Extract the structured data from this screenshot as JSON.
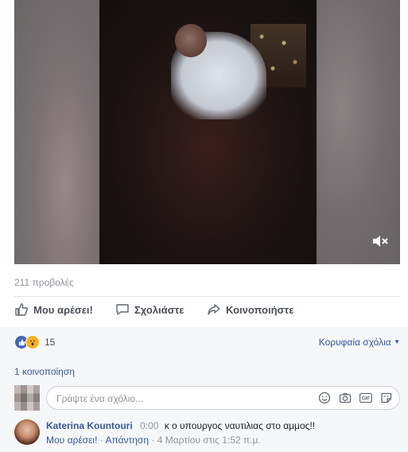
{
  "video": {
    "mute_icon": "volume-mute-icon"
  },
  "post": {
    "views": "211 προβολές"
  },
  "actions": {
    "like": "Μου αρέσει!",
    "comment": "Σχολιάστε",
    "share": "Κοινοποιήστε"
  },
  "reactions": {
    "count": "15",
    "top_comments": "Κορυφαία σχόλια",
    "shares": "1 κοινοποίηση"
  },
  "composer": {
    "placeholder": "Γράψτε ένα σχόλιο...",
    "gif_label": "GIF"
  },
  "comment": {
    "author": "Katerina Kountouri",
    "time": "0:00",
    "text": "κ ο υπουργος ναυτιλιας στο αμμος!!",
    "like": "Μου αρέσει!",
    "reply": "Απάντηση",
    "date": "4 Μαρτίου στις 1:52 π.μ."
  },
  "colors": {
    "link": "#365899",
    "muted": "#90949c",
    "like_blue": "#4267b2"
  }
}
